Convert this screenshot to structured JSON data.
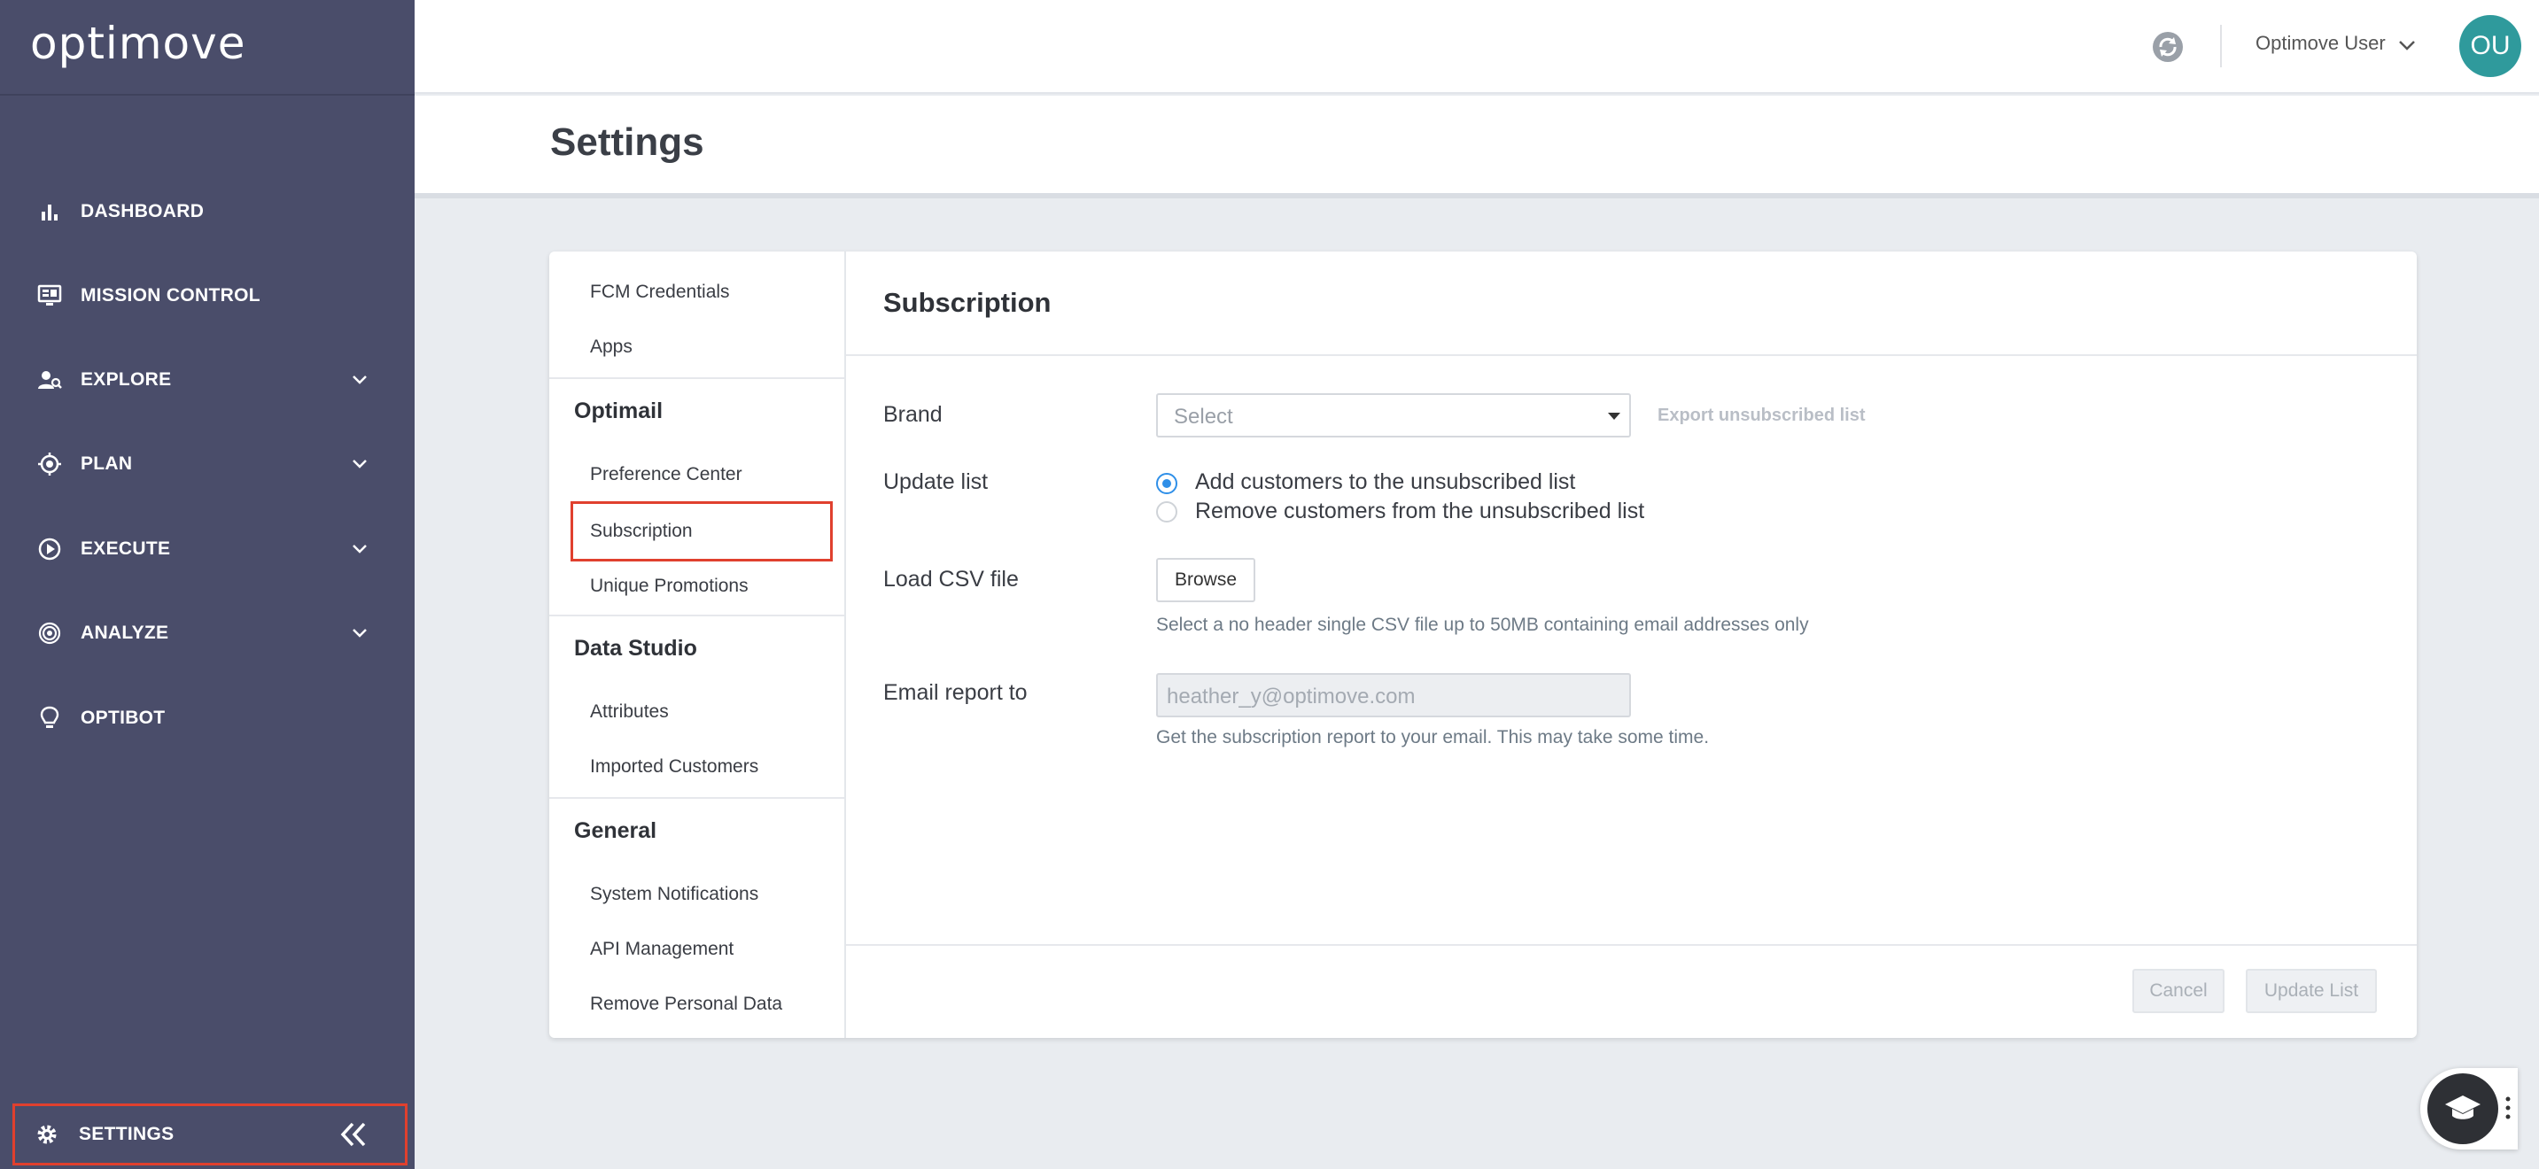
{
  "brand": {
    "logo_text": "optimove"
  },
  "sidebar": {
    "items": [
      {
        "label": "DASHBOARD",
        "icon": "bar-chart-icon"
      },
      {
        "label": "MISSION CONTROL",
        "icon": "monitor-icon"
      },
      {
        "label": "EXPLORE",
        "icon": "person-search-icon",
        "expandable": true
      },
      {
        "label": "PLAN",
        "icon": "target-icon",
        "expandable": true
      },
      {
        "label": "EXECUTE",
        "icon": "play-circle-icon",
        "expandable": true
      },
      {
        "label": "ANALYZE",
        "icon": "fingerprint-icon",
        "expandable": true
      },
      {
        "label": "OPTIBOT",
        "icon": "lightbulb-icon"
      }
    ],
    "settings_label": "SETTINGS"
  },
  "header": {
    "user_name": "Optimove User",
    "avatar_initials": "OU"
  },
  "page": {
    "title": "Settings"
  },
  "settings_menu": {
    "items_top": [
      "FCM Credentials",
      "Apps"
    ],
    "sections": [
      {
        "title": "Optimail",
        "items": [
          "Preference Center",
          "Subscription",
          "Unique Promotions"
        ]
      },
      {
        "title": "Data Studio",
        "items": [
          "Attributes",
          "Imported Customers"
        ]
      },
      {
        "title": "General",
        "items": [
          "System Notifications",
          "API Management",
          "Remove Personal Data"
        ]
      }
    ],
    "selected": "Subscription"
  },
  "subscription": {
    "title": "Subscription",
    "brand_label": "Brand",
    "brand_placeholder": "Select",
    "export_link": "Export unsubscribed list",
    "update_list_label": "Update list",
    "radio_options": [
      "Add customers to the unsubscribed list",
      "Remove customers from the unsubscribed list"
    ],
    "radio_selected": 0,
    "load_csv_label": "Load CSV file",
    "browse_label": "Browse",
    "csv_hint": "Select a no header single CSV file up to 50MB containing email addresses only",
    "email_label": "Email report to",
    "email_placeholder": "heather_y@optimove.com",
    "email_hint": "Get the subscription report to your email. This may take some time.",
    "cancel_label": "Cancel",
    "update_label": "Update List"
  },
  "colors": {
    "sidebar_bg": "#4a4d6a",
    "accent_blue": "#2f8fe8",
    "avatar_bg": "#2f9a9c",
    "highlight_red": "#e0402e"
  }
}
